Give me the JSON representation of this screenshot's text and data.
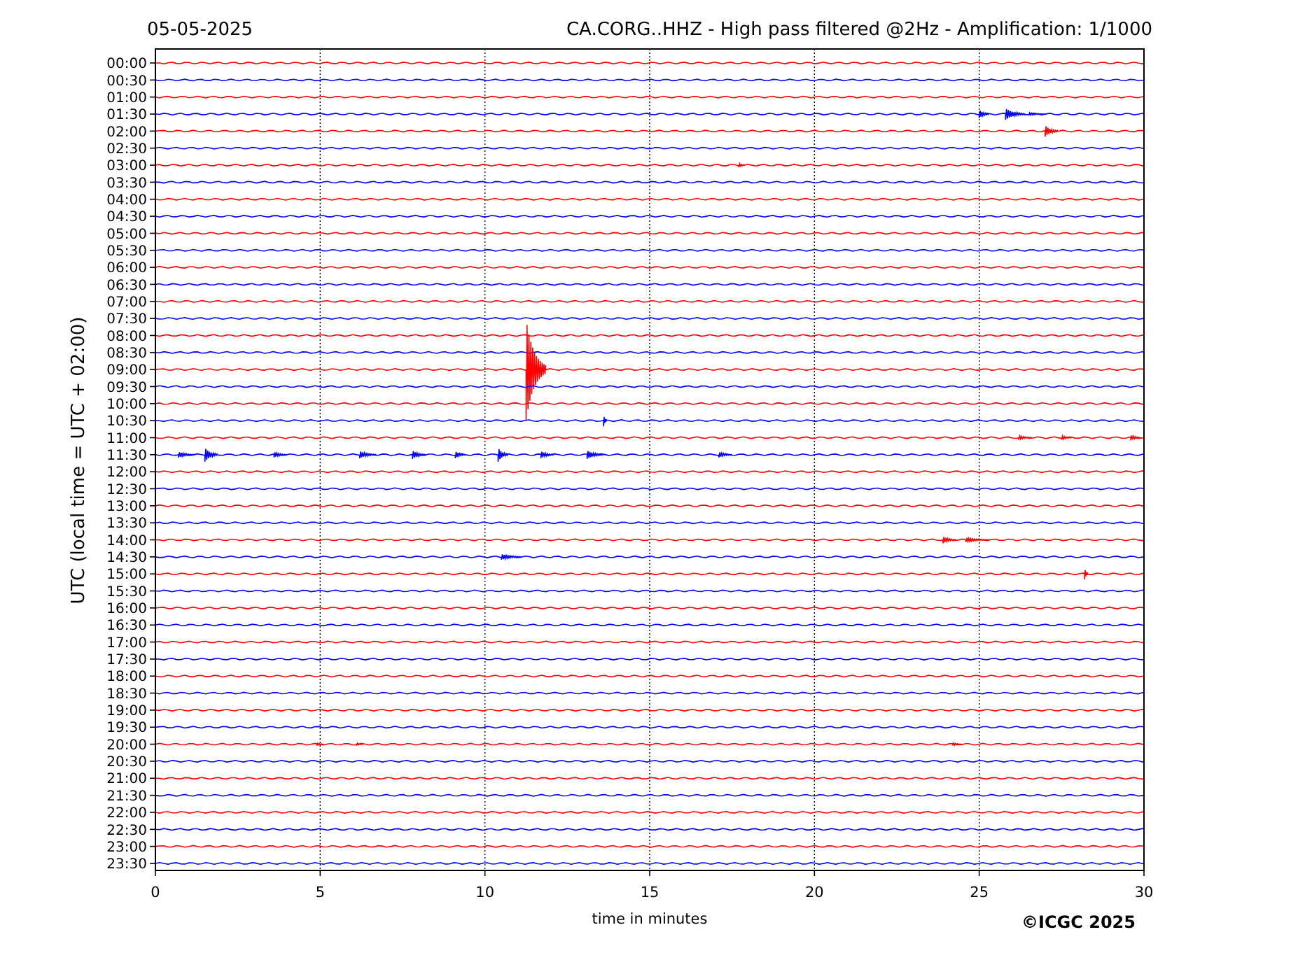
{
  "header": {
    "date": "05-05-2025",
    "title": "CA.CORG..HHZ - High pass filtered @2Hz - Amplification: 1/1000"
  },
  "y_axis": {
    "label": "UTC (local time = UTC + 02:00)"
  },
  "rows": [
    {
      "label": "00:00",
      "color": "#ff0000"
    },
    {
      "label": "00:30",
      "color": "#0000ff"
    },
    {
      "label": "01:00",
      "color": "#ff0000"
    },
    {
      "label": "01:30",
      "color": "#0000ff"
    },
    {
      "label": "02:00",
      "color": "#ff0000"
    },
    {
      "label": "02:30",
      "color": "#0000ff"
    },
    {
      "label": "03:00",
      "color": "#ff0000"
    },
    {
      "label": "03:30",
      "color": "#0000ff"
    },
    {
      "label": "04:00",
      "color": "#ff0000"
    },
    {
      "label": "04:30",
      "color": "#0000ff"
    },
    {
      "label": "05:00",
      "color": "#ff0000"
    },
    {
      "label": "05:30",
      "color": "#0000ff"
    },
    {
      "label": "06:00",
      "color": "#ff0000"
    },
    {
      "label": "06:30",
      "color": "#0000ff"
    },
    {
      "label": "07:00",
      "color": "#ff0000"
    },
    {
      "label": "07:30",
      "color": "#0000ff"
    },
    {
      "label": "08:00",
      "color": "#ff0000"
    },
    {
      "label": "08:30",
      "color": "#0000ff"
    },
    {
      "label": "09:00",
      "color": "#ff0000"
    },
    {
      "label": "09:30",
      "color": "#0000ff"
    },
    {
      "label": "10:00",
      "color": "#ff0000"
    },
    {
      "label": "10:30",
      "color": "#0000ff"
    },
    {
      "label": "11:00",
      "color": "#ff0000"
    },
    {
      "label": "11:30",
      "color": "#0000ff"
    },
    {
      "label": "12:00",
      "color": "#ff0000"
    },
    {
      "label": "12:30",
      "color": "#0000ff"
    },
    {
      "label": "13:00",
      "color": "#ff0000"
    },
    {
      "label": "13:30",
      "color": "#0000ff"
    },
    {
      "label": "14:00",
      "color": "#ff0000"
    },
    {
      "label": "14:30",
      "color": "#0000ff"
    },
    {
      "label": "15:00",
      "color": "#ff0000"
    },
    {
      "label": "15:30",
      "color": "#0000ff"
    },
    {
      "label": "16:00",
      "color": "#ff0000"
    },
    {
      "label": "16:30",
      "color": "#0000ff"
    },
    {
      "label": "17:00",
      "color": "#ff0000"
    },
    {
      "label": "17:30",
      "color": "#0000ff"
    },
    {
      "label": "18:00",
      "color": "#ff0000"
    },
    {
      "label": "18:30",
      "color": "#0000ff"
    },
    {
      "label": "19:00",
      "color": "#ff0000"
    },
    {
      "label": "19:30",
      "color": "#0000ff"
    },
    {
      "label": "20:00",
      "color": "#ff0000"
    },
    {
      "label": "20:30",
      "color": "#0000ff"
    },
    {
      "label": "21:00",
      "color": "#ff0000"
    },
    {
      "label": "21:30",
      "color": "#0000ff"
    },
    {
      "label": "22:00",
      "color": "#ff0000"
    },
    {
      "label": "22:30",
      "color": "#0000ff"
    },
    {
      "label": "23:00",
      "color": "#ff0000"
    },
    {
      "label": "23:30",
      "color": "#0000ff"
    }
  ],
  "x_axis": {
    "ticks": [
      "0",
      "5",
      "10",
      "15",
      "20",
      "25",
      "30"
    ],
    "label": "time in minutes"
  },
  "copyright": "©ICGC 2025"
}
